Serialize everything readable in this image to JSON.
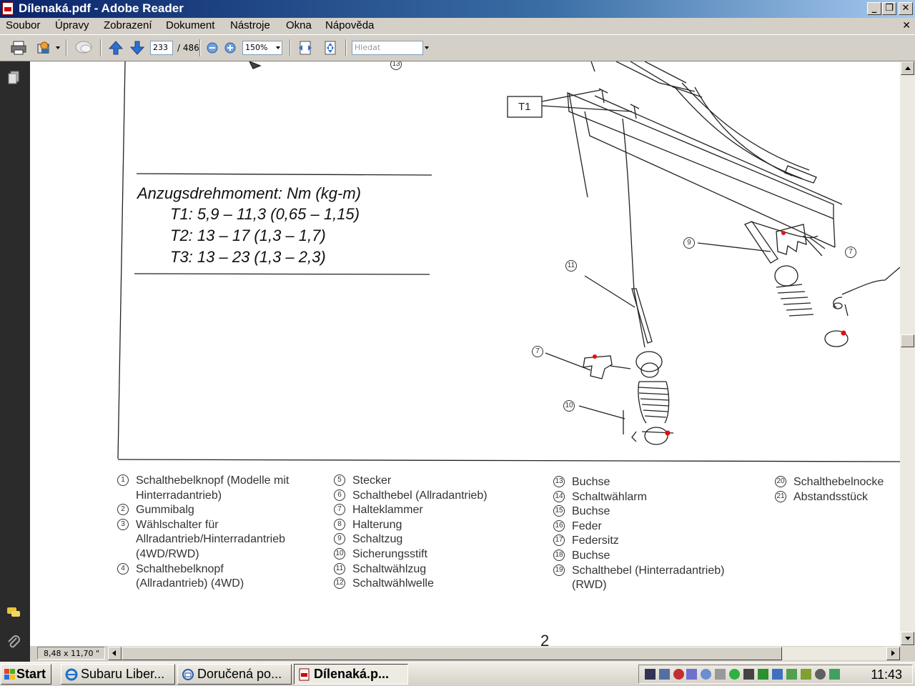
{
  "window": {
    "title": "Dílenaká.pdf - Adobe Reader",
    "caption_buttons": [
      "_",
      "❐",
      "✕"
    ]
  },
  "menu": [
    "Soubor",
    "Úpravy",
    "Zobrazení",
    "Dokument",
    "Nástroje",
    "Okna",
    "Nápověda"
  ],
  "toolbar": {
    "page_current": "233",
    "page_total": "/ 486",
    "zoom": "150%",
    "search_placeholder": "Hledat"
  },
  "document": {
    "torque": {
      "title": "Anzugsdrehmoment:  Nm (kg-m)",
      "lines": [
        "T1: 5,9 – 11,3 (0,65 – 1,15)",
        "T2: 13 – 17 (1,3 – 1,7)",
        "T3: 13 – 23 (1,3 – 2,3)"
      ]
    },
    "diagram_labels": {
      "t1_box": "T1",
      "callouts": [
        "13",
        "9",
        "7",
        "11",
        "7",
        "10"
      ]
    },
    "legend": [
      [
        {
          "num": "1",
          "text": "Schalthebelknopf (Modelle mit",
          "cont": "Hinterradantrieb)"
        },
        {
          "num": "2",
          "text": "Gummibalg"
        },
        {
          "num": "3",
          "text": "Wählschalter für",
          "cont": "Allradantrieb/Hinterradantrieb",
          "cont2": "(4WD/RWD)"
        },
        {
          "num": "4",
          "text": "Schalthebelknopf",
          "cont": "(Allradantrieb) (4WD)"
        }
      ],
      [
        {
          "num": "5",
          "text": "Stecker"
        },
        {
          "num": "6",
          "text": "Schalthebel (Allradantrieb)"
        },
        {
          "num": "7",
          "text": "Halteklammer"
        },
        {
          "num": "8",
          "text": "Halterung"
        },
        {
          "num": "9",
          "text": "Schaltzug"
        },
        {
          "num": "10",
          "text": "Sicherungsstift"
        },
        {
          "num": "11",
          "text": "Schaltwählzug"
        },
        {
          "num": "12",
          "text": "Schaltwählwelle"
        }
      ],
      [
        {
          "num": "13",
          "text": "Buchse"
        },
        {
          "num": "14",
          "text": "Schaltwählarm"
        },
        {
          "num": "15",
          "text": "Buchse"
        },
        {
          "num": "16",
          "text": "Feder"
        },
        {
          "num": "17",
          "text": "Federsitz"
        },
        {
          "num": "18",
          "text": "Buchse"
        },
        {
          "num": "19",
          "text": "Schalthebel (Hinterradantrieb)",
          "cont": "(RWD)"
        }
      ],
      [
        {
          "num": "20",
          "text": "Schalthebelnocke"
        },
        {
          "num": "21",
          "text": "Abstandsstück"
        }
      ]
    ],
    "page_number_fragment": "2"
  },
  "status": {
    "page_size": "8,48 x 11,70 \""
  },
  "taskbar": {
    "start": "Start",
    "tasks": [
      "Subaru Liber...",
      "Doručená po...",
      "Dílenaká.p..."
    ],
    "clock": "11:43"
  }
}
